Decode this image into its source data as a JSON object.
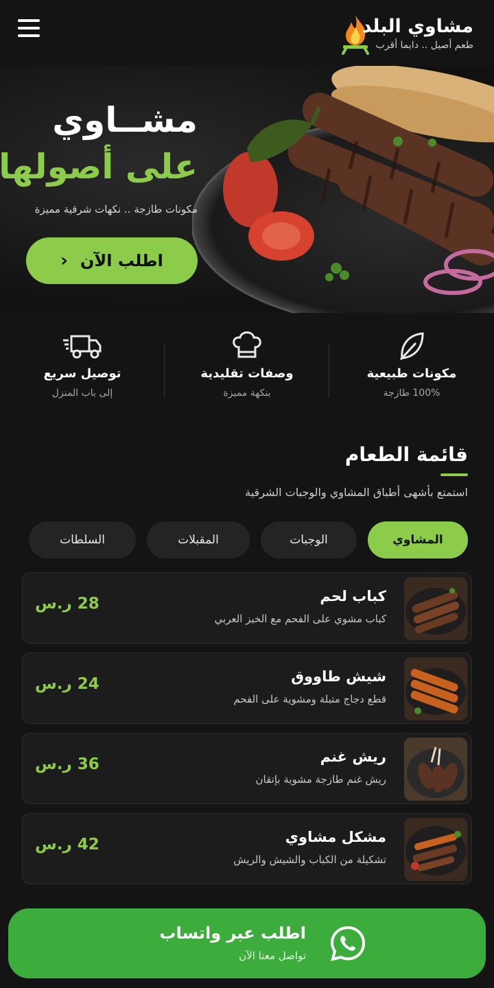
{
  "brand": {
    "name": "مشاوي البلد",
    "tagline": "طعم أصيل .. دايما أقرب"
  },
  "hero": {
    "title_line1": "مشــاوي",
    "title_line2": "على أصولها",
    "subtitle": "مكونات طازجة .. نكهات شرقية مميزة",
    "cta_label": "اطلب الآن",
    "cta_icon": "chevron-left-icon"
  },
  "features": [
    {
      "icon": "leaf-icon",
      "title": "مكونات طبيعية",
      "subtitle": "100% طازجة"
    },
    {
      "icon": "chef-hat-icon",
      "title": "وصفات تقليدية",
      "subtitle": "بنكهة مميزة"
    },
    {
      "icon": "delivery-truck-icon",
      "title": "توصيل سريع",
      "subtitle": "إلى باب المنزل"
    }
  ],
  "menu": {
    "title": "قائمة الطعام",
    "subtitle": "استمتع بأشهى أطباق المشاوي والوجبات الشرقية",
    "tabs": [
      {
        "label": "المشاوي",
        "active": true
      },
      {
        "label": "الوجبات",
        "active": false
      },
      {
        "label": "المقبلات",
        "active": false
      },
      {
        "label": "السلطات",
        "active": false
      }
    ],
    "items": [
      {
        "name": "كباب لحم",
        "description": "كباب مشوي على الفحم مع الخبز العربي",
        "price": "28 ر.س"
      },
      {
        "name": "شيش طاووق",
        "description": "قطع دجاج متبلة ومشوية على الفحم",
        "price": "24 ر.س"
      },
      {
        "name": "ريش غنم",
        "description": "ريش غنم طازجة مشوية بإتقان",
        "price": "36 ر.س"
      },
      {
        "name": "مشكل مشاوي",
        "description": "تشكيلة من الكباب والشيش والريش",
        "price": "42 ر.س"
      }
    ]
  },
  "whatsapp": {
    "title": "اطلب عبر واتساب",
    "subtitle": "تواصل معنا الآن",
    "icon": "whatsapp-icon"
  },
  "colors": {
    "accent": "#8dcc4a",
    "background": "#141414",
    "whatsapp": "#3cad3c"
  }
}
